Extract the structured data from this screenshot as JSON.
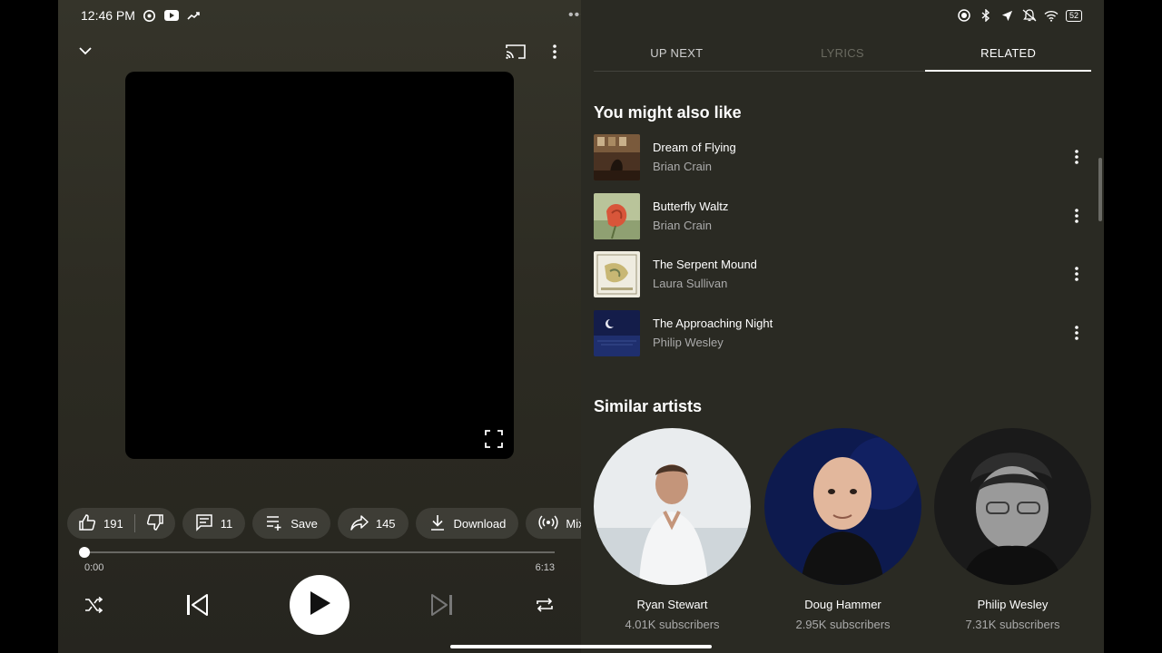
{
  "status_bar": {
    "time": "12:46 PM",
    "battery": "52"
  },
  "player": {
    "actions": {
      "likes": "191",
      "comments": "11",
      "save_label": "Save",
      "share_count": "145",
      "download_label": "Download",
      "mix_label": "Mix"
    },
    "progress": {
      "current": "0:00",
      "total": "6:13",
      "fraction": 0.0
    }
  },
  "tabs": [
    {
      "label": "UP NEXT",
      "state": "normal"
    },
    {
      "label": "LYRICS",
      "state": "disabled"
    },
    {
      "label": "RELATED",
      "state": "active"
    }
  ],
  "related": {
    "might_like_title": "You might also like",
    "songs": [
      {
        "title": "Dream of Flying",
        "artist": "Brian Crain"
      },
      {
        "title": "Butterfly Waltz",
        "artist": "Brian Crain"
      },
      {
        "title": "The Serpent Mound",
        "artist": "Laura Sullivan"
      },
      {
        "title": "The Approaching Night",
        "artist": "Philip Wesley"
      }
    ],
    "similar_title": "Similar artists",
    "artists": [
      {
        "name": "Ryan Stewart",
        "subscribers": "4.01K subscribers"
      },
      {
        "name": "Doug Hammer",
        "subscribers": "2.95K subscribers"
      },
      {
        "name": "Philip Wesley",
        "subscribers": "7.31K subscribers"
      }
    ]
  }
}
